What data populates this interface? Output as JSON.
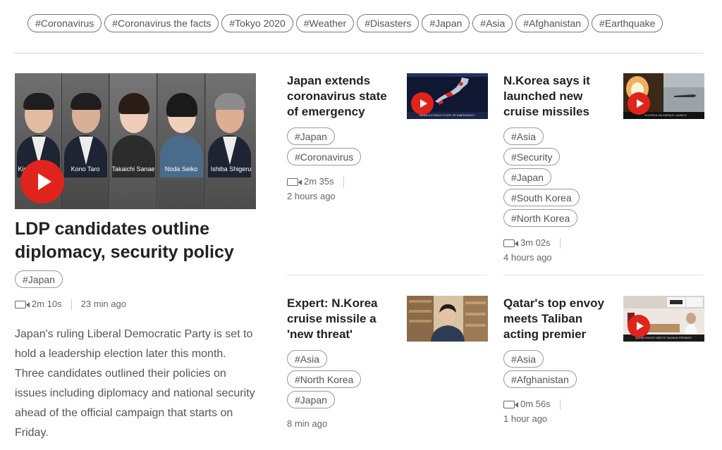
{
  "topics": [
    "#Coronavirus",
    "#Coronavirus the facts",
    "#Tokyo 2020",
    "#Weather",
    "#Disasters",
    "#Japan",
    "#Asia",
    "#Afghanistan",
    "#Earthquake"
  ],
  "featured": {
    "portrait_names": [
      "Kishida Fumio",
      "Kono Taro",
      "Takaichi Sanae",
      "Noda Seiko",
      "Ishiba Shigeru"
    ],
    "title": "LDP candidates outline diplomacy, security policy",
    "tags": [
      "#Japan"
    ],
    "duration": "2m 10s",
    "time": "23 min ago",
    "description": "Japan's ruling Liberal Democratic Party is set to hold a leadership election later this month. Three candidates outlined their policies on issues including diplomacy and national security ahead of the official campaign that starts on Friday."
  },
  "cards": [
    {
      "title": "Japan extends coronavirus state of emergency",
      "tags": [
        "#Japan",
        "#Coronavirus"
      ],
      "duration": "2m 35s",
      "time": "2 hours ago"
    },
    {
      "title": "N.Korea says it launched new cruise missiles",
      "tags": [
        "#Asia",
        "#Security",
        "#Japan",
        "#South Korea",
        "#North Korea"
      ],
      "duration": "3m 02s",
      "time": "4 hours ago"
    },
    {
      "title": "Expert: N.Korea cruise missile a 'new threat'",
      "tags": [
        "#Asia",
        "#North Korea",
        "#Japan"
      ],
      "time": "8 min ago"
    },
    {
      "title": "Qatar's top envoy meets Taliban acting premier",
      "tags": [
        "#Asia",
        "#Afghanistan"
      ],
      "duration": "0m 56s",
      "time": "1 hour ago"
    }
  ],
  "colors": {
    "accent_red": "#e0241c",
    "title_text": "#222222",
    "muted_text": "#666666"
  }
}
